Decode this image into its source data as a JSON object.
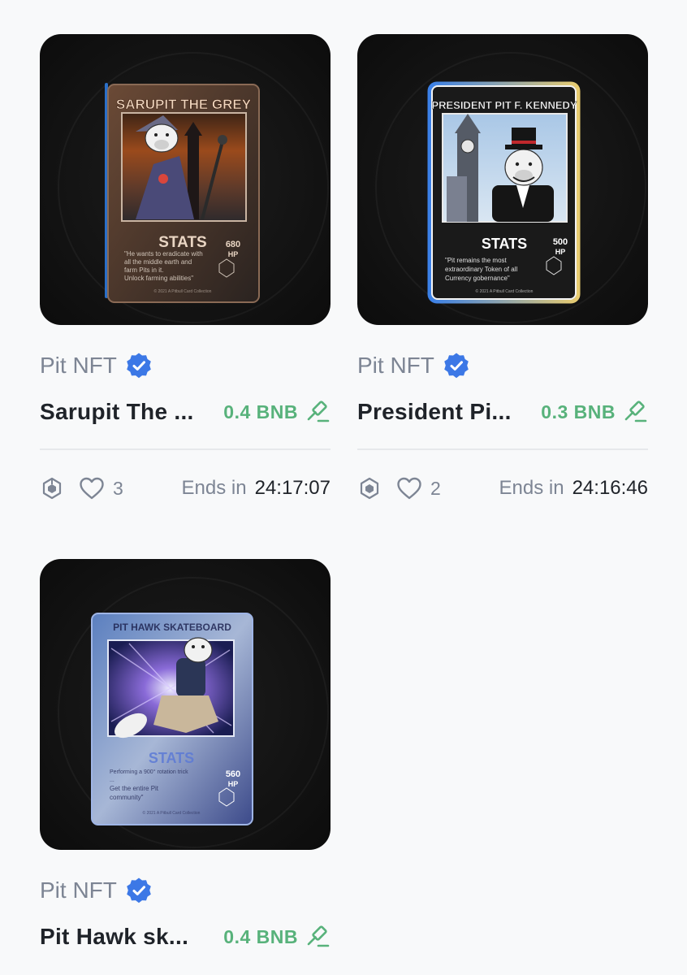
{
  "items": [
    {
      "creator": "Pit NFT",
      "title": "Sarupit The ...",
      "price": "0.4 BNB",
      "likes": "3",
      "ends_label": "Ends in",
      "ends_time": "24:17:07",
      "art": {
        "header": "SARUPIT THE GREY",
        "stats": "STATS",
        "hp": "680",
        "hp_unit": "HP",
        "desc": [
          "\"He wants to eradicate with",
          "all the middle earth and",
          "farm Pits in it.",
          "Unlock farming abilities\""
        ],
        "footer": "© 2021 A Pitbull Card Collection"
      }
    },
    {
      "creator": "Pit NFT",
      "title": "President Pi...",
      "price": "0.3 BNB",
      "likes": "2",
      "ends_label": "Ends in",
      "ends_time": "24:16:46",
      "art": {
        "header": "PRESIDENT PIT F. KENNEDY",
        "stats": "STATS",
        "hp": "500",
        "hp_unit": "HP",
        "desc": [
          "\"Pit remains the most",
          "extraordinary Token of all",
          "Currency gobernance\""
        ],
        "footer": "© 2021 A Pitbull Card Collection"
      }
    },
    {
      "creator": "Pit NFT",
      "title": "Pit Hawk sk...",
      "price": "0.4 BNB",
      "art": {
        "header": "PIT HAWK SKATEBOARD",
        "stats": "STATS",
        "hp": "560",
        "hp_unit": "HP",
        "desc": [
          "Performing a 900° rotation trick",
          "...",
          "Get the entire Pit",
          "community\""
        ],
        "footer": "© 2021 A Pitbull Card Collection"
      }
    }
  ],
  "colors": {
    "accent_green": "#58b27b",
    "verified_blue": "#3c78e6",
    "muted_text": "#7d8594",
    "title_text": "#1f2329"
  },
  "icons": {
    "verified": "verified-badge-icon",
    "price": "gavel-icon",
    "chain": "bnb-chain-icon",
    "like": "heart-icon"
  }
}
